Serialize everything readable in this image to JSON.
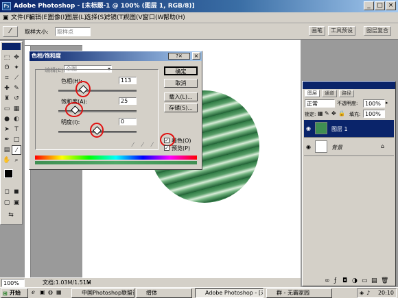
{
  "window": {
    "title": "Adobe Photoshop - [未标题-1 @ 100% (图层 1, RGB/8)]",
    "app_logo": "Ps",
    "controls": {
      "minimize": "_",
      "restore": "□",
      "close": "×"
    }
  },
  "menubar": [
    "文件(F)",
    "编辑(E)",
    "图像(I)",
    "图层(L)",
    "选择(S)",
    "滤镜(T)",
    "视图(V)",
    "窗口(W)",
    "帮助(H)"
  ],
  "options": {
    "sample_size_label": "取样大小:",
    "sample_size_value": "取样点",
    "palette_tabs": [
      "画笔",
      "工具预设",
      "图层复合"
    ]
  },
  "dialog": {
    "title": "色相/饱和度",
    "edit_label": "编辑(E):",
    "edit_value": "全图",
    "hue_label": "色相(H):",
    "hue_value": "113",
    "saturation_label": "饱和度(A):",
    "saturation_value": "25",
    "lightness_label": "明度(I):",
    "lightness_value": "0",
    "buttons": {
      "ok": "确定",
      "cancel": "取消",
      "load": "载入(L)...",
      "save": "存储(S)..."
    },
    "colorize_label": "着色(O)",
    "preview_label": "预览(P)",
    "colorize_checked": true,
    "preview_checked": true,
    "slider_positions": {
      "hue": 0.3,
      "saturation": 0.18,
      "lightness": 0.5
    }
  },
  "layers_panel": {
    "tabs": [
      "图层",
      "通道",
      "路径"
    ],
    "blend_mode": "正常",
    "opacity_label": "不透明度:",
    "opacity_value": "100%",
    "lock_label": "锁定:",
    "fill_label": "填充:",
    "fill_value": "100%",
    "layers": [
      {
        "name": "图层 1",
        "selected": true
      },
      {
        "name": "背景",
        "selected": false
      }
    ]
  },
  "status": {
    "zoom": "100%",
    "doc_info": "文档:1.03M/1.51M"
  },
  "taskbar": {
    "start": "开始",
    "items": [
      "中国Photoshop联盟论坛...",
      "缯体",
      "Adobe Photoshop - [未标...",
      "群 - 无霸家园"
    ],
    "clock": "20:10"
  },
  "colors": {
    "title_blue": "#0a246a",
    "dialog_gray": "#d4d0c8",
    "accent_green": "#3f8f52",
    "annotation_red": "#e01010"
  }
}
